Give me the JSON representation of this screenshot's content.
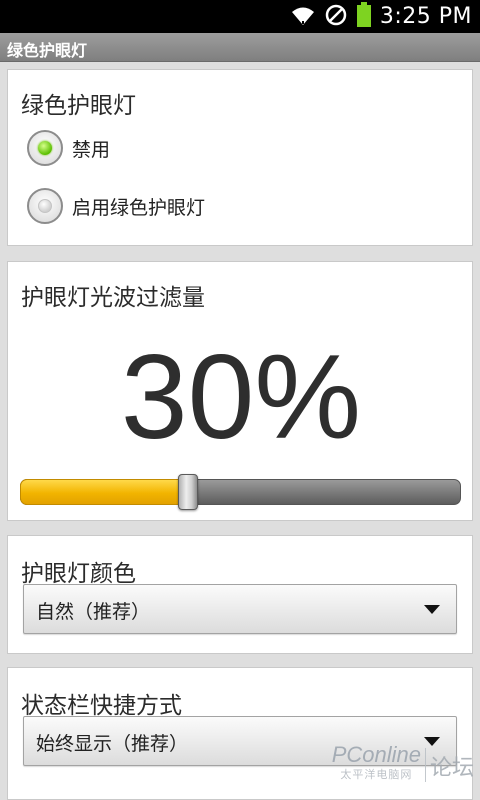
{
  "status_bar": {
    "time": "3:25 PM",
    "icons": [
      "wifi-icon",
      "no-signal-icon",
      "battery-icon"
    ],
    "battery_color": "#7ed321"
  },
  "app": {
    "title": "绿色护眼灯"
  },
  "sections": {
    "mode": {
      "title": "绿色护眼灯",
      "options": [
        {
          "label": "禁用",
          "selected": true
        },
        {
          "label": "启用绿色护眼灯",
          "selected": false
        }
      ]
    },
    "filter": {
      "title": "护眼灯光波过滤量",
      "value_text": "30%",
      "level": 0.38,
      "fill_color": "#f2b400"
    },
    "color": {
      "title": "护眼灯颜色",
      "selected": "自然（推荐）"
    },
    "status_shortcut": {
      "title": "状态栏快捷方式",
      "selected": "始终显示（推荐）"
    }
  },
  "watermark": {
    "brand": "PConline",
    "sub": "太平洋电脑网",
    "forum": "论坛"
  },
  "colors": {
    "radio_on": "#5bbf00",
    "title_bar": "#8f8f8f"
  }
}
